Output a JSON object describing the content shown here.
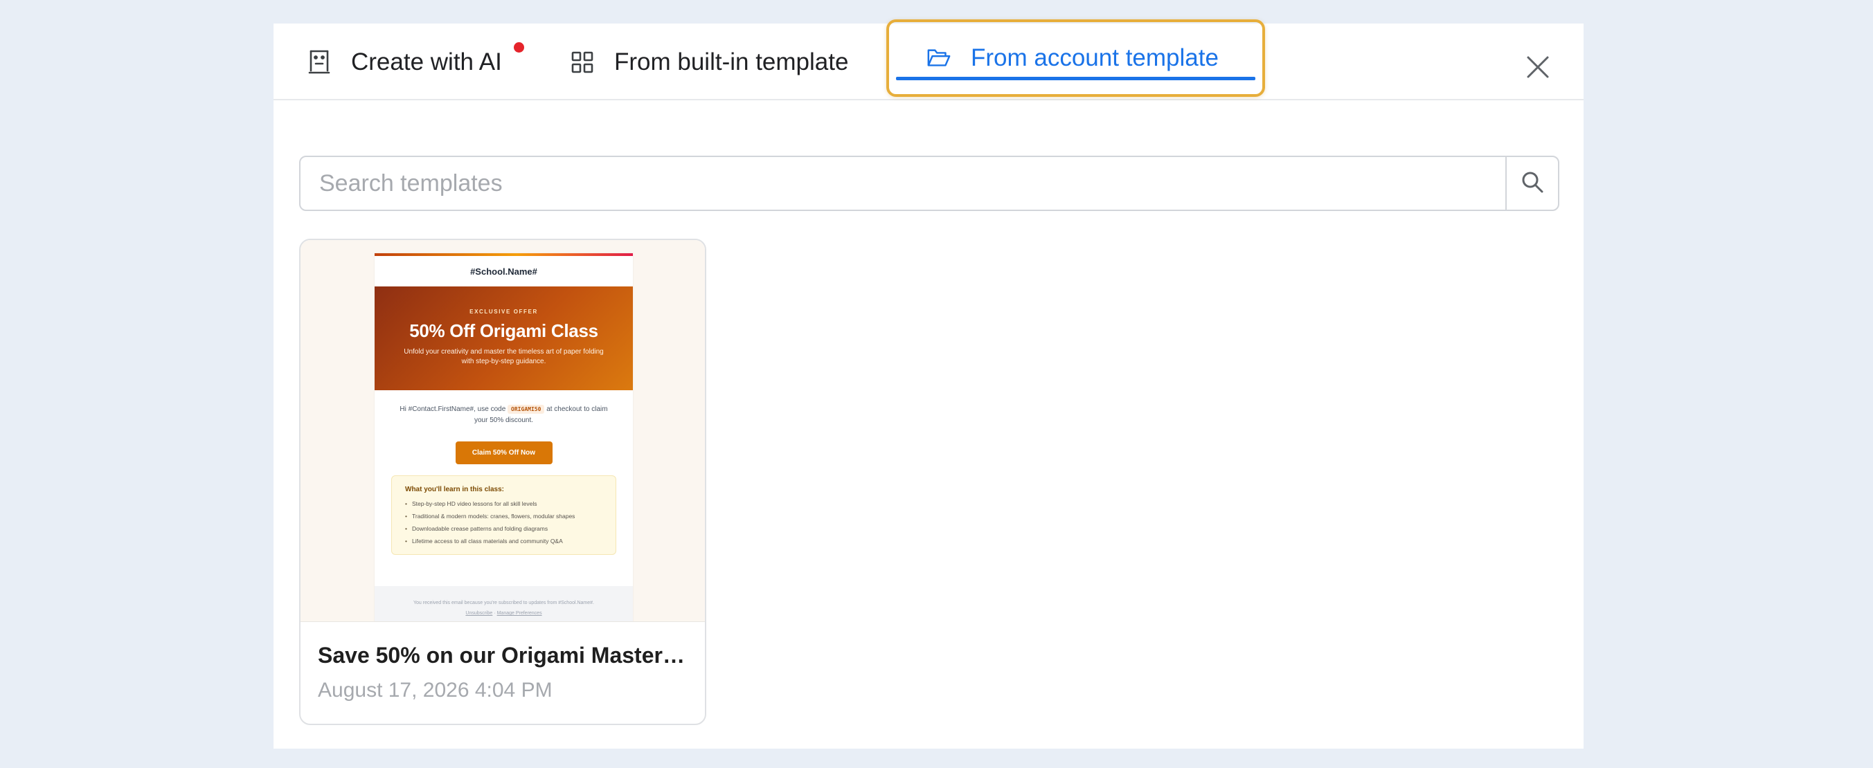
{
  "tabs": {
    "ai": {
      "label": "Create with AI",
      "icon": "robot-icon",
      "has_badge": true
    },
    "builtin": {
      "label": "From built-in template",
      "icon": "grid-icon"
    },
    "account": {
      "label": "From account template",
      "icon": "folder-open-icon",
      "active": true
    }
  },
  "close": {
    "icon": "close-icon"
  },
  "search": {
    "placeholder": "Search templates",
    "value": "",
    "icon": "search-icon"
  },
  "templates": [
    {
      "title": "Save 50% on our Origami Masterc...",
      "date": "August 17, 2026 4:04 PM",
      "preview": {
        "school_name": "#School.Name#",
        "kicker": "EXCLUSIVE OFFER",
        "headline": "50% Off Origami Class",
        "subheadline": "Unfold your creativity and master the timeless art of paper folding with step-by-step guidance.",
        "greeting_before": "Hi #Contact.FirstName#, use code",
        "code": "ORIGAMI50",
        "greeting_after": "at checkout to claim your 50% discount.",
        "cta": "Claim 50% Off Now",
        "learn_title": "What you'll learn in this class:",
        "learn_items": [
          "Step-by-step HD video lessons for all skill levels",
          "Traditional & modern models: cranes, flowers, modular shapes",
          "Downloadable crease patterns and folding diagrams",
          "Lifetime access to all class materials and community Q&A"
        ],
        "footer_text": "You received this email because you're subscribed to updates from #School.Name#.",
        "unsubscribe": "Unsubscribe",
        "separator": "·",
        "manage": "Manage Preferences"
      }
    }
  ],
  "colors": {
    "accent": "#1a73e8",
    "highlight_border": "#e7ae3b",
    "badge": "#e5242b",
    "background": "#e8eef6"
  }
}
